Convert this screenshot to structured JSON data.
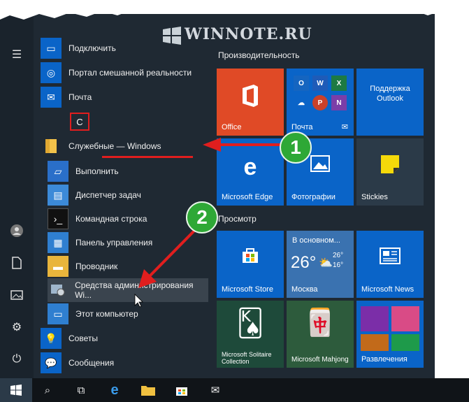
{
  "watermark": "WINNOTE.RU",
  "colors": {
    "tile_blue": "#0a64c8",
    "office_red": "#e04a26",
    "badge_green": "#2ea836",
    "annotation_red": "#e01e1e"
  },
  "section_letter": "С",
  "apps": [
    {
      "label": "Подключить",
      "icon": "connect-icon"
    },
    {
      "label": "Портал смешанной реальности",
      "icon": "mixed-reality-icon"
    },
    {
      "label": "Почта",
      "icon": "mail-icon"
    }
  ],
  "folder": {
    "label": "Служебные — Windows",
    "icon": "folder-icon"
  },
  "sub_apps": [
    {
      "label": "Выполнить",
      "icon": "run-icon"
    },
    {
      "label": "Диспетчер задач",
      "icon": "task-manager-icon"
    },
    {
      "label": "Командная строка",
      "icon": "cmd-icon"
    },
    {
      "label": "Панель управления",
      "icon": "control-panel-icon"
    },
    {
      "label": "Проводник",
      "icon": "explorer-icon"
    },
    {
      "label": "Средства администрирования Wi...",
      "icon": "admin-tools-icon"
    },
    {
      "label": "Этот компьютер",
      "icon": "computer-icon"
    }
  ],
  "bottom_apps": [
    {
      "label": "Советы",
      "icon": "tips-icon"
    },
    {
      "label": "Сообщения",
      "icon": "messages-icon"
    }
  ],
  "groups": {
    "productivity": "Производительность",
    "browse": "Просмотр"
  },
  "tiles": {
    "office": "Office",
    "mail_tile": "Почта",
    "outlook_support": "Поддержка Outlook",
    "edge": "Microsoft Edge",
    "photos": "Фотографии",
    "stickies": "Stickies",
    "store": "Microsoft Store",
    "weather": {
      "condition": "В основном...",
      "temp": "26°",
      "high": "26°",
      "low": "16°",
      "city": "Москва"
    },
    "news": "Microsoft News",
    "solitaire": "Microsoft Solitaire Collection",
    "mahjong": "Microsoft Mahjong",
    "entertainment": "Развлечения"
  },
  "badges": [
    "1",
    "2"
  ]
}
